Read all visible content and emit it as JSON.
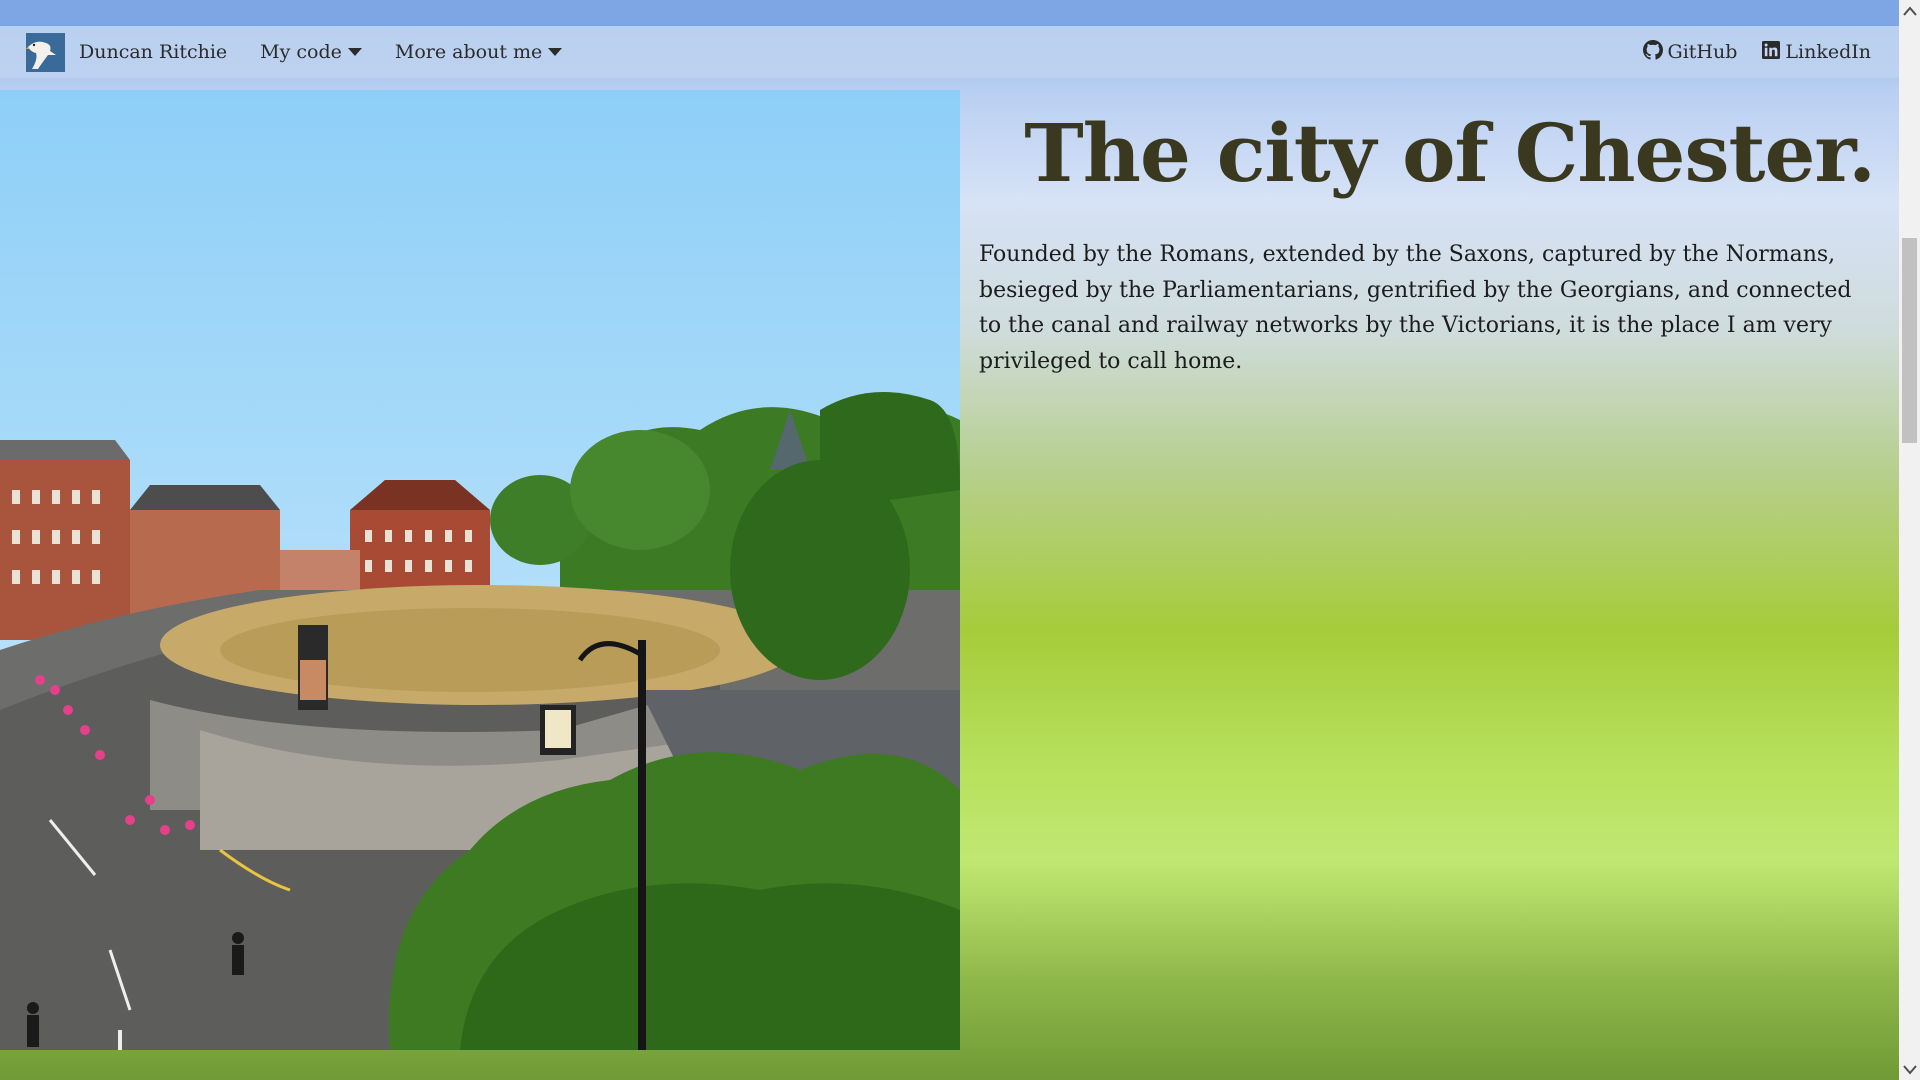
{
  "nav": {
    "brand_name": "Duncan Ritchie",
    "menu_code": "My code",
    "menu_more": "More about me",
    "github": "GitHub",
    "linkedin": "LinkedIn"
  },
  "icons": {
    "brand": "eagle-logo",
    "dropdown": "caret-down-icon",
    "github": "github-icon",
    "linkedin": "linkedin-icon"
  },
  "hero": {
    "title": "The city of Chester.",
    "intro": "Founded by the Romans, extended by the Saxons, captured by the Normans, besieged by the Parliamentarians, gentrified by the Georgians, and connected to the canal and railway networks by the Victorians, it is the place I am very privileged to call home."
  },
  "colors": {
    "title": "#3a3920",
    "navbar": "#bed2f0"
  }
}
